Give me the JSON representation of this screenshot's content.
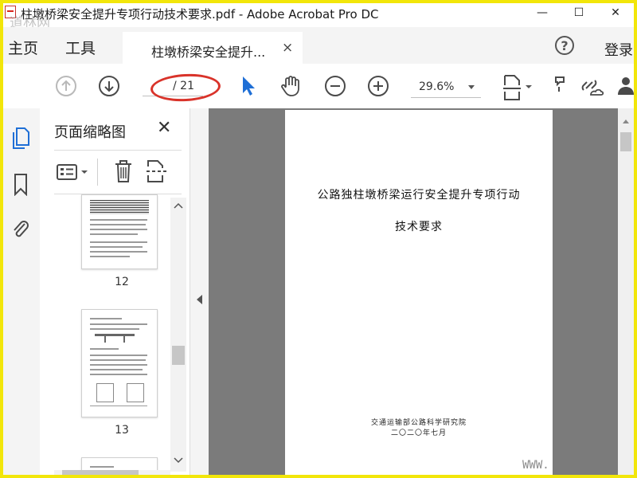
{
  "window": {
    "title": "柱墩桥梁安全提升专项行动技术要求.pdf - Adobe Acrobat Pro DC",
    "watermark": "道林网",
    "minimize": "—",
    "maximize": "☐",
    "close": "✕"
  },
  "menu": {
    "home": "主页",
    "tools": "工具",
    "tab_label": "柱墩桥梁安全提升...",
    "tab_close": "×",
    "help": "?",
    "login": "登录"
  },
  "toolbar": {
    "page_total": "/ 21",
    "zoom": "29.6%",
    "highlight_color": "#d9332a",
    "accent_color": "#1f6fd6"
  },
  "panel": {
    "title": "页面缩略图",
    "close": "✕",
    "thumbnails": [
      {
        "page": "12"
      },
      {
        "page": "13"
      }
    ]
  },
  "document": {
    "title_line1": "公路独柱墩桥梁运行安全提升专项行动",
    "title_line2": "技术要求",
    "publisher": "交通运输部公路科学研究院",
    "date": "二〇二〇年七月",
    "watermark": "WWW."
  }
}
